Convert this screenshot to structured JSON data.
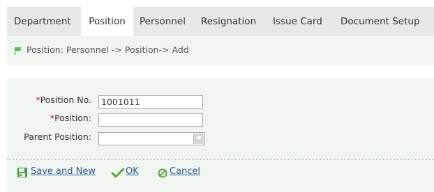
{
  "tabs": [
    {
      "label": "Department",
      "active": false
    },
    {
      "label": "Position",
      "active": true
    },
    {
      "label": "Personnel",
      "active": false
    },
    {
      "label": "Resignation",
      "active": false
    },
    {
      "label": "Issue Card",
      "active": false
    },
    {
      "label": "Document Setup",
      "active": false
    }
  ],
  "breadcrumb": {
    "text": "Position: Personnel -> Position-> Add",
    "icon": "flag-icon"
  },
  "form": {
    "required_mark": "*",
    "position_no": {
      "label": "Position No.",
      "value": "1001011"
    },
    "position": {
      "label": "Position:",
      "value": ""
    },
    "parent_position": {
      "label": "Parent Position:",
      "value": ""
    }
  },
  "actions": {
    "save_and_new": {
      "label": "Save and New",
      "icon": "save-icon"
    },
    "ok": {
      "label": "OK",
      "icon": "checkmark-icon"
    },
    "cancel": {
      "label": "Cancel",
      "icon": "cancel-icon"
    }
  },
  "colors": {
    "tab_bar_bg": "#e8e8e8",
    "panel_bg": "#f0f5f2",
    "flag_green": "#5cb85c",
    "required_red": "#d0021b",
    "link_blue": "#2c5c8f",
    "ok_green": "#5aa832"
  }
}
